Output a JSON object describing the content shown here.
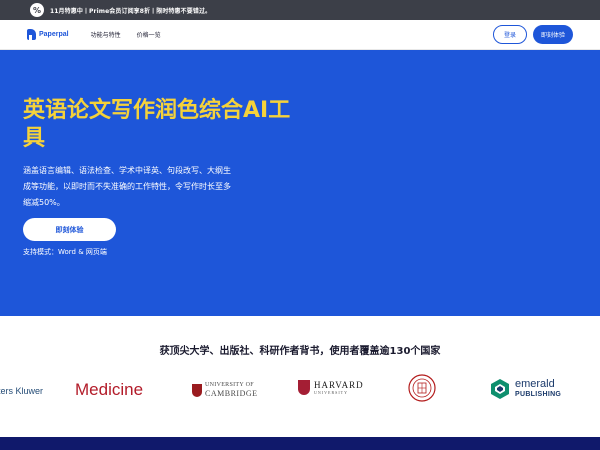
{
  "promo": {
    "badge": "%",
    "text": "11月特惠中丨Prime会员订阅享8折丨限时特惠不要错过。"
  },
  "nav": {
    "brand": "Paperpal",
    "links": [
      "功能与特性",
      "价格一览"
    ],
    "login_label": "登录",
    "try_label": "即刻体验"
  },
  "hero": {
    "title": "英语论文写作润色综合AI工具",
    "description": "涵盖语言编辑、语法检查、学术中译英、句段改写、大纲生成等功能，以即时而不失准确的工作特性，令写作时长至多缩减50%。",
    "cta_label": "即刻体验",
    "support_text": "支持模式：Word & 网页端"
  },
  "trust": {
    "title": "获顶尖大学、出版社、科研作者背书，使用者覆盖逾130个国家",
    "logos": {
      "kluwer": "ters Kluwer",
      "medicine": "Medicine",
      "cambridge_l1": "UNIVERSITY OF",
      "cambridge_l2": "CAMBRIDGE",
      "harvard_l1": "HARVARD",
      "harvard_l2": "UNIVERSITY",
      "emerald_l1": "emerald",
      "emerald_l2": "PUBLISHING"
    }
  },
  "colors": {
    "brand_blue": "#1e56d9",
    "title_yellow": "#f5d23a",
    "promo_bg": "#3c3f48",
    "footer_navy": "#10196b"
  }
}
